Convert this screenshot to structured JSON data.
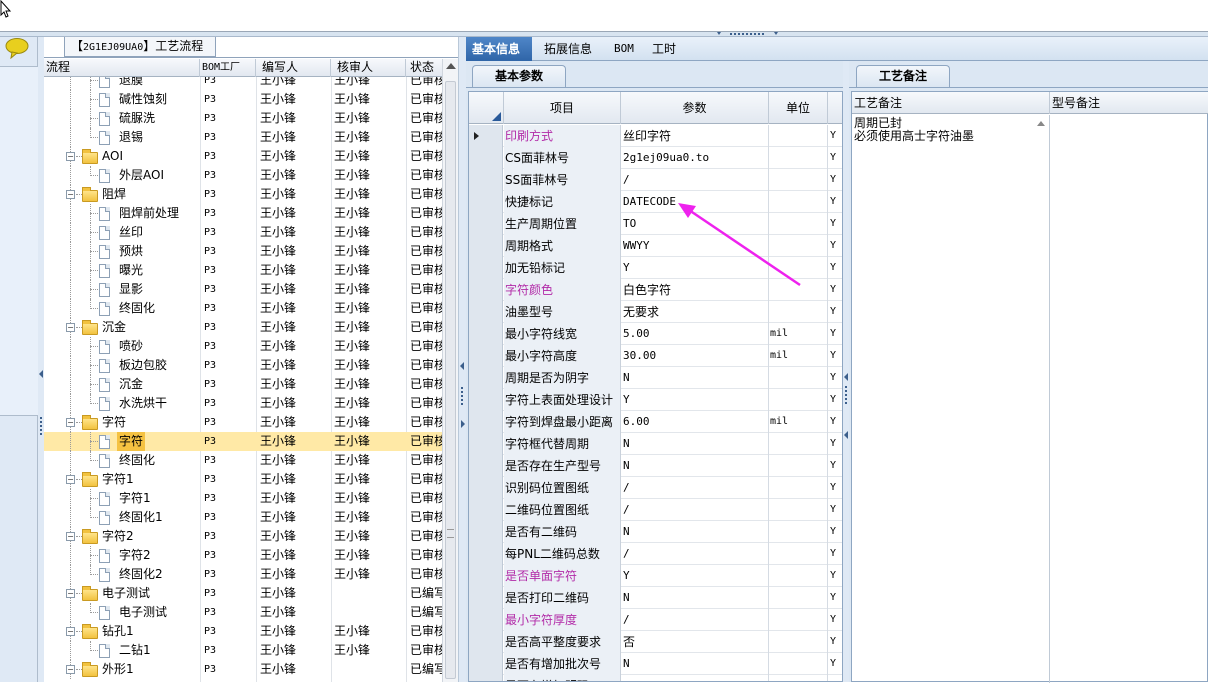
{
  "process_panel": {
    "title_prefix": "【",
    "title_code": "2G1EJ09UA0",
    "title_suffix": "】工艺流程",
    "columns": [
      "流程",
      "BOM工厂",
      "编写人",
      "核审人",
      "状态"
    ],
    "rows": [
      {
        "level": 2,
        "kind": "doc",
        "name": "退膜",
        "bom": "P3",
        "writer": "王小锋",
        "reviewer": "王小锋",
        "status": "已审核",
        "partial": true
      },
      {
        "level": 2,
        "kind": "doc",
        "name": "碱性蚀刻",
        "bom": "P3",
        "writer": "王小锋",
        "reviewer": "王小锋",
        "status": "已审核"
      },
      {
        "level": 2,
        "kind": "doc",
        "name": "硫脲洗",
        "bom": "P3",
        "writer": "王小锋",
        "reviewer": "王小锋",
        "status": "已审核"
      },
      {
        "level": 2,
        "kind": "doc",
        "name": "退锡",
        "bom": "P3",
        "writer": "王小锋",
        "reviewer": "王小锋",
        "status": "已审核"
      },
      {
        "level": 1,
        "kind": "folder",
        "name": "AOI",
        "bom": "P3",
        "writer": "王小锋",
        "reviewer": "王小锋",
        "status": "已审核"
      },
      {
        "level": 2,
        "kind": "doc",
        "name": "外层AOI",
        "bom": "P3",
        "writer": "王小锋",
        "reviewer": "王小锋",
        "status": "已审核"
      },
      {
        "level": 1,
        "kind": "folder",
        "name": "阻焊",
        "bom": "P3",
        "writer": "王小锋",
        "reviewer": "王小锋",
        "status": "已审核"
      },
      {
        "level": 2,
        "kind": "doc",
        "name": "阻焊前处理",
        "bom": "P3",
        "writer": "王小锋",
        "reviewer": "王小锋",
        "status": "已审核"
      },
      {
        "level": 2,
        "kind": "doc",
        "name": "丝印",
        "bom": "P3",
        "writer": "王小锋",
        "reviewer": "王小锋",
        "status": "已审核"
      },
      {
        "level": 2,
        "kind": "doc",
        "name": "预烘",
        "bom": "P3",
        "writer": "王小锋",
        "reviewer": "王小锋",
        "status": "已审核"
      },
      {
        "level": 2,
        "kind": "doc",
        "name": "曝光",
        "bom": "P3",
        "writer": "王小锋",
        "reviewer": "王小锋",
        "status": "已审核"
      },
      {
        "level": 2,
        "kind": "doc",
        "name": "显影",
        "bom": "P3",
        "writer": "王小锋",
        "reviewer": "王小锋",
        "status": "已审核"
      },
      {
        "level": 2,
        "kind": "doc",
        "name": "终固化",
        "bom": "P3",
        "writer": "王小锋",
        "reviewer": "王小锋",
        "status": "已审核"
      },
      {
        "level": 1,
        "kind": "folder",
        "name": "沉金",
        "bom": "P3",
        "writer": "王小锋",
        "reviewer": "王小锋",
        "status": "已审核"
      },
      {
        "level": 2,
        "kind": "doc",
        "name": "喷砂",
        "bom": "P3",
        "writer": "王小锋",
        "reviewer": "王小锋",
        "status": "已审核"
      },
      {
        "level": 2,
        "kind": "doc",
        "name": "板边包胶",
        "bom": "P3",
        "writer": "王小锋",
        "reviewer": "王小锋",
        "status": "已审核"
      },
      {
        "level": 2,
        "kind": "doc",
        "name": "沉金",
        "bom": "P3",
        "writer": "王小锋",
        "reviewer": "王小锋",
        "status": "已审核"
      },
      {
        "level": 2,
        "kind": "doc",
        "name": "水洗烘干",
        "bom": "P3",
        "writer": "王小锋",
        "reviewer": "王小锋",
        "status": "已审核"
      },
      {
        "level": 1,
        "kind": "folder",
        "name": "字符",
        "bom": "P3",
        "writer": "王小锋",
        "reviewer": "王小锋",
        "status": "已审核"
      },
      {
        "level": 2,
        "kind": "doc",
        "name": "字符",
        "bom": "P3",
        "writer": "王小锋",
        "reviewer": "王小锋",
        "status": "已审核",
        "selected": true
      },
      {
        "level": 2,
        "kind": "doc",
        "name": "终固化",
        "bom": "P3",
        "writer": "王小锋",
        "reviewer": "王小锋",
        "status": "已审核"
      },
      {
        "level": 1,
        "kind": "folder",
        "name": "字符1",
        "bom": "P3",
        "writer": "王小锋",
        "reviewer": "王小锋",
        "status": "已审核"
      },
      {
        "level": 2,
        "kind": "doc",
        "name": "字符1",
        "bom": "P3",
        "writer": "王小锋",
        "reviewer": "王小锋",
        "status": "已审核"
      },
      {
        "level": 2,
        "kind": "doc",
        "name": "终固化1",
        "bom": "P3",
        "writer": "王小锋",
        "reviewer": "王小锋",
        "status": "已审核"
      },
      {
        "level": 1,
        "kind": "folder",
        "name": "字符2",
        "bom": "P3",
        "writer": "王小锋",
        "reviewer": "王小锋",
        "status": "已审核"
      },
      {
        "level": 2,
        "kind": "doc",
        "name": "字符2",
        "bom": "P3",
        "writer": "王小锋",
        "reviewer": "王小锋",
        "status": "已审核"
      },
      {
        "level": 2,
        "kind": "doc",
        "name": "终固化2",
        "bom": "P3",
        "writer": "王小锋",
        "reviewer": "王小锋",
        "status": "已审核"
      },
      {
        "level": 1,
        "kind": "folder",
        "name": "电子测试",
        "bom": "P3",
        "writer": "王小锋",
        "reviewer": "",
        "status": "已编写"
      },
      {
        "level": 2,
        "kind": "doc",
        "name": "电子测试",
        "bom": "P3",
        "writer": "王小锋",
        "reviewer": "",
        "status": "已编写"
      },
      {
        "level": 1,
        "kind": "folder",
        "name": "钻孔1",
        "bom": "P3",
        "writer": "王小锋",
        "reviewer": "王小锋",
        "status": "已审核"
      },
      {
        "level": 2,
        "kind": "doc",
        "name": "二钻1",
        "bom": "P3",
        "writer": "王小锋",
        "reviewer": "王小锋",
        "status": "已审核"
      },
      {
        "level": 1,
        "kind": "folder",
        "name": "外形1",
        "bom": "P3",
        "writer": "王小锋",
        "reviewer": "",
        "status": "已编写"
      }
    ]
  },
  "tabs": [
    {
      "label": "基本信息",
      "active": true
    },
    {
      "label": "拓展信息",
      "active": false
    },
    {
      "label": "BOM",
      "active": false
    },
    {
      "label": "工时",
      "active": false
    }
  ],
  "basic_panel": {
    "tab_label": "基本参数",
    "columns": {
      "item": "项目",
      "param": "参数",
      "unit": "单位"
    },
    "rows": [
      {
        "item": "印刷方式",
        "value": "丝印字符",
        "unit": "",
        "flag": "Y",
        "pink": true,
        "current": true
      },
      {
        "item": "CS面菲林号",
        "value": "2g1ej09ua0.to",
        "unit": "",
        "flag": "Y"
      },
      {
        "item": "SS面菲林号",
        "value": "/",
        "unit": "",
        "flag": "Y"
      },
      {
        "item": "快捷标记",
        "value": "DATECODE",
        "unit": "",
        "flag": "Y"
      },
      {
        "item": "生产周期位置",
        "value": "TO",
        "unit": "",
        "flag": "Y"
      },
      {
        "item": "周期格式",
        "value": "WWYY",
        "unit": "",
        "flag": "Y"
      },
      {
        "item": "加无铅标记",
        "value": "Y",
        "unit": "",
        "flag": "Y"
      },
      {
        "item": "字符颜色",
        "value": "白色字符",
        "unit": "",
        "flag": "Y",
        "pink": true
      },
      {
        "item": "油墨型号",
        "value": "无要求",
        "unit": "",
        "flag": "Y"
      },
      {
        "item": "最小字符线宽",
        "value": "5.00",
        "unit": "mil",
        "flag": "Y"
      },
      {
        "item": "最小字符高度",
        "value": "30.00",
        "unit": "mil",
        "flag": "Y"
      },
      {
        "item": "周期是否为阴字",
        "value": "N",
        "unit": "",
        "flag": "Y"
      },
      {
        "item": "字符上表面处理设计",
        "value": "Y",
        "unit": "",
        "flag": "Y"
      },
      {
        "item": "字符到焊盘最小距离",
        "value": "6.00",
        "unit": "mil",
        "flag": "Y"
      },
      {
        "item": "字符框代替周期",
        "value": "N",
        "unit": "",
        "flag": "Y"
      },
      {
        "item": "是否存在生产型号",
        "value": "N",
        "unit": "",
        "flag": "Y"
      },
      {
        "item": "识别码位置图纸",
        "value": "/",
        "unit": "",
        "flag": "Y"
      },
      {
        "item": "二维码位置图纸",
        "value": "/",
        "unit": "",
        "flag": "Y"
      },
      {
        "item": "是否有二维码",
        "value": "N",
        "unit": "",
        "flag": "Y"
      },
      {
        "item": "每PNL二维码总数",
        "value": "/",
        "unit": "",
        "flag": "Y"
      },
      {
        "item": "是否单面字符",
        "value": "Y",
        "unit": "",
        "flag": "Y",
        "pink": true
      },
      {
        "item": "是否打印二维码",
        "value": "N",
        "unit": "",
        "flag": "Y"
      },
      {
        "item": "最小字符厚度",
        "value": "/",
        "unit": "",
        "flag": "Y",
        "pink": true
      },
      {
        "item": "是否高平整度要求",
        "value": "否",
        "unit": "",
        "flag": "Y"
      },
      {
        "item": "是否有增加批次号",
        "value": "N",
        "unit": "",
        "flag": "Y"
      },
      {
        "item": "是否有增加明码",
        "value": "N",
        "unit": "",
        "flag": "Y",
        "partial": true
      }
    ]
  },
  "notes_panel": {
    "tab_label": "工艺备注",
    "columns": [
      "工艺备注",
      "型号备注"
    ],
    "lines": [
      "周期已封",
      "必须使用高士字符油墨"
    ]
  },
  "colors": {
    "pink_label": "#b22ba8",
    "selection": "#ffe9a6",
    "tab_active": "#2f65a8",
    "annotation_arrow": "#ee22ee"
  }
}
